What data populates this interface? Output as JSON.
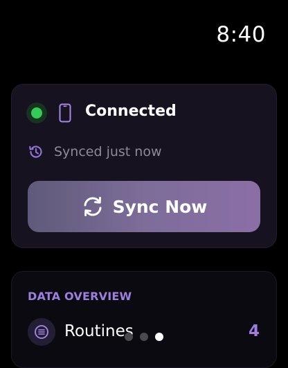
{
  "clock": {
    "time": "8:40"
  },
  "connection_card": {
    "status": "Connected",
    "status_color": "#33cc55",
    "synced_text": "Synced just now",
    "sync_button_label": "Sync Now"
  },
  "data_overview": {
    "title": "DATA OVERVIEW",
    "items": [
      {
        "label": "Routines",
        "count": "4",
        "icon": "list-icon"
      }
    ]
  },
  "pager": {
    "pages": 3,
    "active_index": 2
  },
  "colors": {
    "accent": "#9d7fe0",
    "background": "#000000"
  }
}
